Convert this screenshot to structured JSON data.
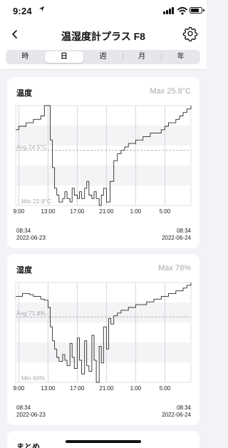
{
  "status_bar": {
    "time": "9:24",
    "location_icon": "location-arrow-icon",
    "signal_icon": "cellular-signal-icon",
    "wifi_icon": "wifi-icon",
    "battery_icon": "battery-icon"
  },
  "nav": {
    "back_icon": "chevron-left-icon",
    "title": "温湿度計プラス F8",
    "settings_icon": "gear-icon"
  },
  "segments": {
    "items": [
      "時",
      "日",
      "週",
      "月",
      "年"
    ],
    "selected": "日"
  },
  "temperature_card": {
    "title": "温度",
    "max_label": "Max 25.8°C",
    "avg_label": "Avg 24.5°C",
    "min_label": "Min 22.9°C",
    "start_time": "08:34",
    "start_date": "2022-06-23",
    "end_time": "08:34",
    "end_date": "2022-06-24"
  },
  "humidity_card": {
    "title": "湿度",
    "max_label": "Max 78%",
    "avg_label": "Avg 71.8%",
    "min_label": "Min 60%",
    "start_time": "08:34",
    "start_date": "2022-06-23",
    "end_time": "08:34",
    "end_date": "2022-06-24"
  },
  "summary": {
    "title": "まとめ"
  },
  "colors": {
    "accent_line": "#2b2b2b",
    "card_bg": "#ffffff",
    "page_bg": "#f2f2f7",
    "muted_text": "#a9a9ae"
  },
  "chart_data": [
    {
      "type": "line",
      "title": "温度",
      "unit": "°C",
      "x_tick_labels": [
        "9:00",
        "13:00",
        "17:00",
        "21:00",
        "1:00",
        "5:00"
      ],
      "x_range": [
        8.57,
        32.57
      ],
      "ylim": [
        22.9,
        25.8
      ],
      "avg": 24.5,
      "grid": true,
      "series": [
        {
          "x": [
            8.57,
            9.0,
            9.5,
            10.0,
            10.5,
            11.0,
            11.5,
            12.0,
            12.5,
            13.0,
            13.3,
            13.6,
            13.9,
            14.2,
            14.5,
            15.0,
            15.3,
            15.6,
            16.0,
            16.3,
            16.6,
            17.0,
            17.3,
            17.6,
            18.0,
            18.3,
            18.6,
            19.0,
            19.3,
            19.6,
            20.0,
            20.3,
            20.6,
            21.0,
            21.5,
            22.0,
            22.5,
            23.0,
            23.5,
            24.0,
            24.5,
            25.0,
            25.5,
            26.0,
            26.5,
            27.0,
            27.5,
            28.0,
            28.5,
            29.0,
            29.5,
            30.0,
            30.5,
            31.0,
            31.5,
            32.0,
            32.57
          ],
          "y": [
            25.1,
            25.2,
            25.2,
            25.3,
            25.3,
            25.4,
            25.4,
            25.5,
            25.8,
            25.8,
            24.8,
            24.0,
            23.4,
            23.2,
            23.0,
            23.1,
            23.3,
            23.1,
            23.0,
            23.4,
            23.2,
            23.1,
            23.3,
            23.1,
            23.4,
            23.6,
            23.2,
            23.1,
            23.3,
            23.1,
            22.9,
            23.2,
            23.4,
            23.0,
            23.6,
            24.2,
            24.4,
            24.5,
            24.6,
            24.7,
            24.7,
            24.8,
            24.8,
            24.9,
            24.9,
            25.0,
            25.0,
            25.0,
            25.1,
            25.2,
            25.3,
            25.3,
            25.4,
            25.5,
            25.6,
            25.7,
            25.8
          ]
        }
      ]
    },
    {
      "type": "line",
      "title": "湿度",
      "unit": "%",
      "x_tick_labels": [
        "9:00",
        "13:00",
        "17:00",
        "21:00",
        "1:00",
        "5:00"
      ],
      "x_range": [
        8.57,
        32.57
      ],
      "ylim": [
        60,
        78
      ],
      "avg": 71.8,
      "grid": true,
      "series": [
        {
          "x": [
            8.57,
            9.0,
            9.5,
            10.0,
            10.5,
            11.0,
            11.5,
            12.0,
            12.5,
            13.0,
            13.3,
            13.6,
            13.9,
            14.2,
            14.5,
            15.0,
            15.3,
            15.6,
            16.0,
            16.3,
            16.6,
            17.0,
            17.3,
            17.6,
            18.0,
            18.3,
            18.6,
            19.0,
            19.3,
            19.6,
            20.0,
            20.3,
            20.6,
            21.0,
            21.3,
            21.6,
            22.0,
            22.5,
            23.0,
            23.5,
            24.0,
            24.5,
            25.0,
            25.5,
            26.0,
            26.5,
            27.0,
            27.5,
            28.0,
            28.5,
            29.0,
            29.5,
            30.0,
            30.5,
            31.0,
            31.5,
            32.0,
            32.57
          ],
          "y": [
            75.5,
            75.5,
            76.0,
            76.0,
            75.8,
            75.5,
            75.5,
            75.0,
            74.8,
            73.5,
            70.0,
            67.5,
            66.0,
            64.5,
            63.8,
            65.0,
            64.0,
            63.0,
            67.0,
            64.5,
            62.5,
            68.0,
            64.0,
            61.5,
            67.5,
            63.0,
            62.0,
            68.5,
            64.0,
            60.0,
            66.5,
            63.5,
            70.0,
            66.0,
            71.5,
            70.5,
            72.0,
            72.5,
            73.0,
            73.0,
            73.5,
            73.5,
            74.0,
            74.0,
            74.0,
            74.5,
            74.5,
            75.0,
            75.0,
            75.5,
            75.5,
            76.0,
            76.0,
            76.5,
            76.5,
            77.0,
            77.5,
            78.0
          ]
        }
      ]
    }
  ]
}
